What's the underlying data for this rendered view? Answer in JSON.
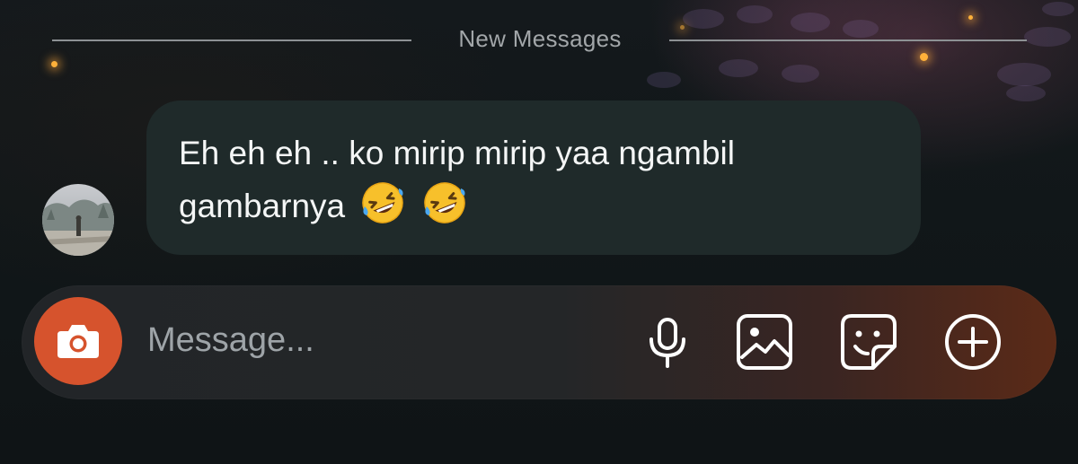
{
  "divider": {
    "label": "New Messages"
  },
  "message": {
    "line1": "Eh eh eh .. ko mirip mirip yaa ngambil",
    "line2": "gambarnya",
    "emoji_name": "rolling-on-the-floor-laughing"
  },
  "composer": {
    "placeholder": "Message..."
  },
  "icons": {
    "camera": "camera-icon",
    "microphone": "microphone-icon",
    "gallery": "image-icon",
    "sticker": "sticker-icon",
    "more": "plus-circle-icon"
  },
  "colors": {
    "camera_button": "#d6532d",
    "bubble": "#1f2a2a",
    "background": "#0f1518"
  }
}
